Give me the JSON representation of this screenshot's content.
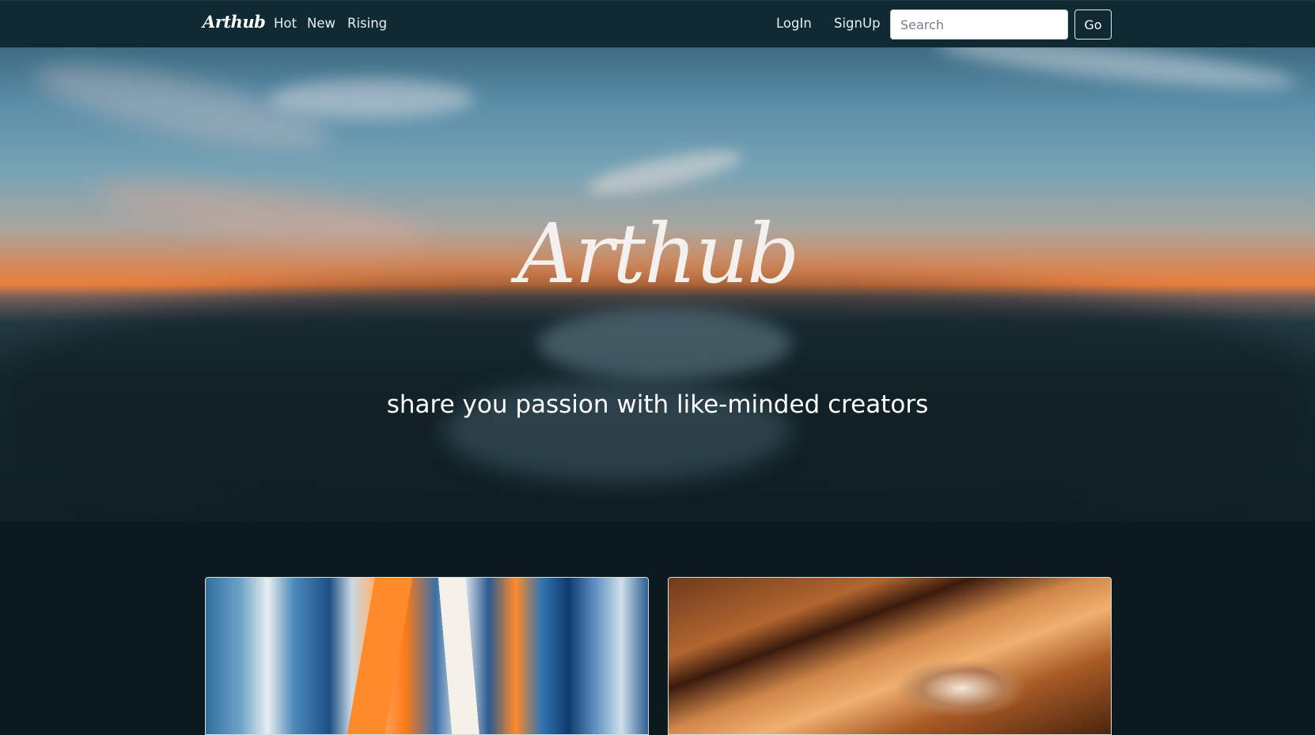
{
  "nav": {
    "brand": "Arthub",
    "links": [
      "Hot",
      "New",
      "Rising"
    ],
    "login": "LogIn",
    "signup": "SignUp",
    "search_placeholder": "Search",
    "go_label": "Go"
  },
  "hero": {
    "title": "Arthub",
    "tagline": "share you passion with like-minded creators"
  },
  "colors": {
    "navbar_bg": "#0f2a33",
    "page_bg": "#0c1a1e",
    "text": "#ffffff"
  }
}
